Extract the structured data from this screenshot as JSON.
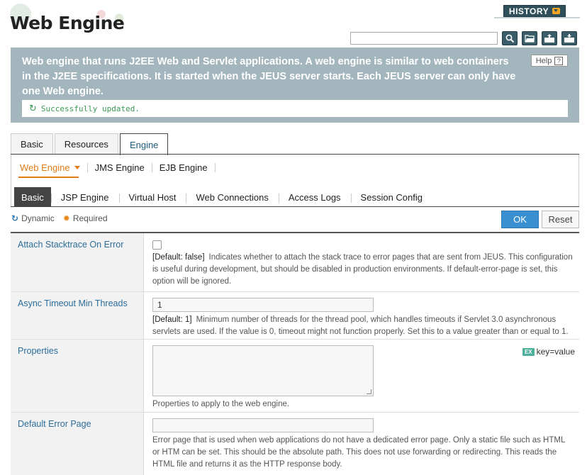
{
  "header": {
    "title": "Web Engine",
    "history_label": "HISTORY",
    "search": {
      "value": "",
      "placeholder": ""
    },
    "tools": [
      "search-icon",
      "folder-open-icon",
      "xml-export-icon",
      "xml-import-icon"
    ]
  },
  "description": {
    "text": "Web engine that runs J2EE Web and Servlet applications. A web engine is similar to web containers in the J2EE specifications. It is started when the JEUS server starts. Each JEUS server can only have one Web engine.",
    "help_label": "Help",
    "help_icon": "?",
    "status": "Successfully updated."
  },
  "tabs_main": [
    {
      "label": "Basic",
      "active": false
    },
    {
      "label": "Resources",
      "active": false
    },
    {
      "label": "Engine",
      "active": true
    }
  ],
  "tabs_engine": [
    {
      "label": "Web Engine",
      "active": true
    },
    {
      "label": "JMS Engine",
      "active": false
    },
    {
      "label": "EJB Engine",
      "active": false
    }
  ],
  "tabs_web": [
    {
      "label": "Basic",
      "active": true
    },
    {
      "label": "JSP Engine",
      "active": false
    },
    {
      "label": "Virtual Host",
      "active": false
    },
    {
      "label": "Web Connections",
      "active": false
    },
    {
      "label": "Access Logs",
      "active": false
    },
    {
      "label": "Session Config",
      "active": false
    }
  ],
  "legend": {
    "dynamic": "Dynamic",
    "required": "Required"
  },
  "actions": {
    "ok": "OK",
    "reset": "Reset"
  },
  "fields": {
    "attach_stacktrace": {
      "label": "Attach Stacktrace On Error",
      "checked": false,
      "default": "[Default: false]",
      "description": "Indicates whether to attach the stack trace to error pages that are sent from JEUS. This configuration is useful during development, but should be disabled in production environments. If default-error-page is set, this option will be ignored."
    },
    "async_timeout": {
      "label": "Async Timeout Min Threads",
      "value": "1",
      "default": "[Default: 1]",
      "description": "Minimum number of threads for the thread pool, which handles timeouts if Servlet 3.0 asynchronous servlets are used. If the value is 0, timeout might not function properly. Set this to a value greater than or equal to 1."
    },
    "properties": {
      "label": "Properties",
      "value": "",
      "example_badge": "EX",
      "example": "key=value",
      "description": "Properties to apply to the web engine."
    },
    "default_error_page": {
      "label": "Default Error Page",
      "value": "",
      "description": "Error page that is used when web applications do not have a dedicated error page. Only a static file such as HTML or HTM can be set. This should be the absolute path. This does not use forwarding or redirecting. This reads the HTML file and returns it as the HTTP response body."
    }
  }
}
